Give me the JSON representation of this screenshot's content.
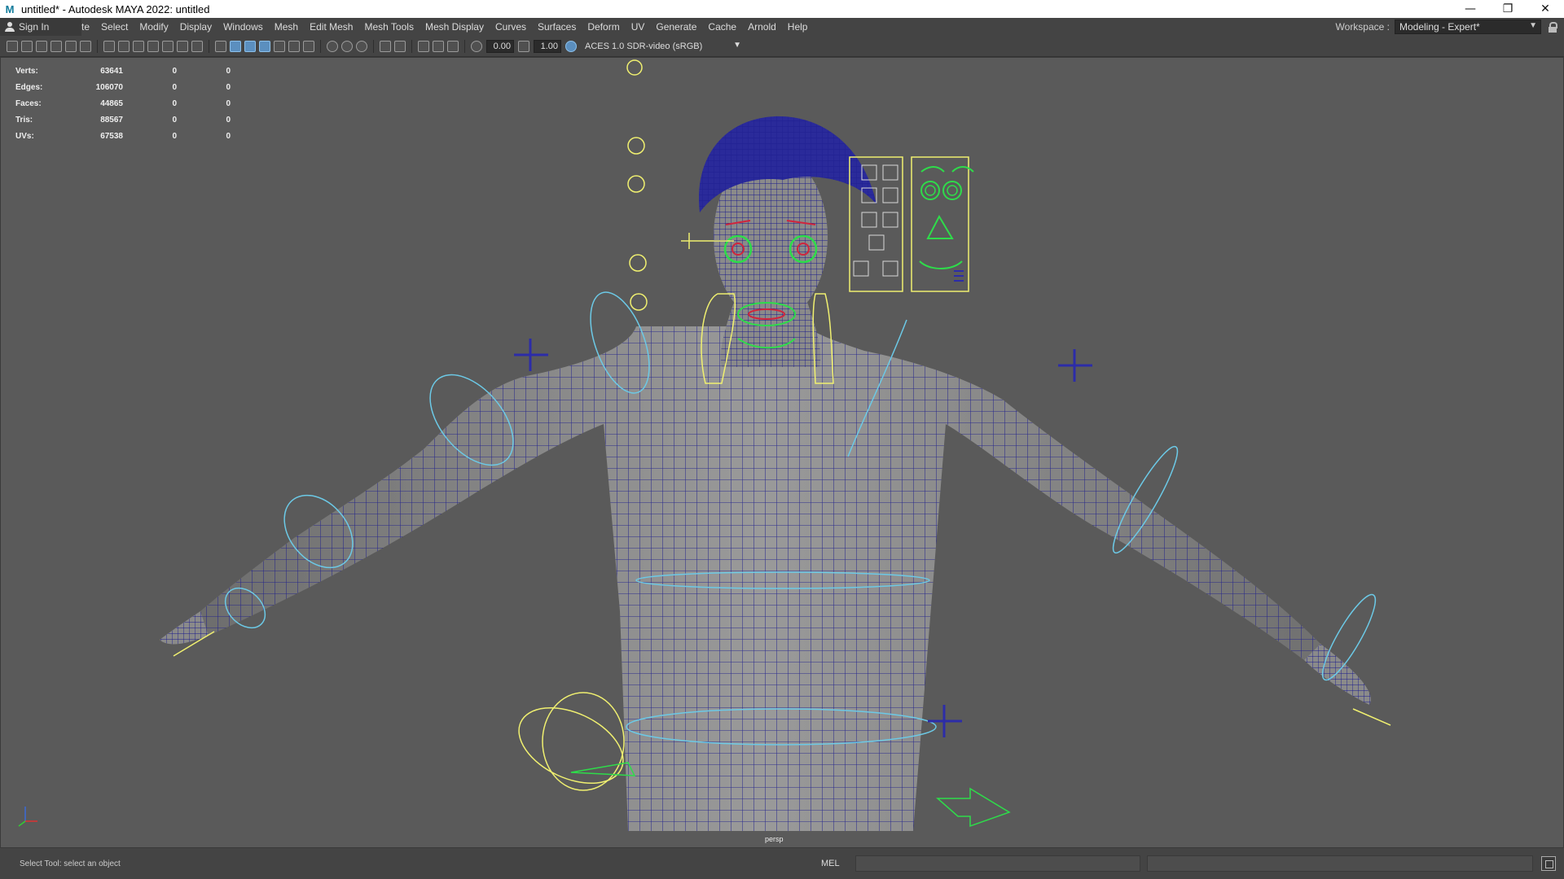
{
  "window": {
    "title": "untitled* - Autodesk MAYA 2022: untitled",
    "app_icon": "M",
    "controls": {
      "minimize": "—",
      "restore": "❐",
      "close": "✕"
    }
  },
  "menubar": {
    "sign_in": "Sign In",
    "menus": [
      "te",
      "Select",
      "Modify",
      "Display",
      "Windows",
      "Mesh",
      "Edit Mesh",
      "Mesh Tools",
      "Mesh Display",
      "Curves",
      "Surfaces",
      "Deform",
      "UV",
      "Generate",
      "Cache",
      "Arnold",
      "Help"
    ],
    "workspace_label": "Workspace :",
    "workspace_value": "Modeling - Expert*"
  },
  "toolbar": {
    "exposure": "0.00",
    "gamma": "1.00",
    "color_space": "ACES 1.0 SDR-video (sRGB)"
  },
  "hud": {
    "rows": [
      {
        "label": "Verts:",
        "values": [
          "63641",
          "0",
          "0"
        ]
      },
      {
        "label": "Edges:",
        "values": [
          "106070",
          "0",
          "0"
        ]
      },
      {
        "label": "Faces:",
        "values": [
          "44865",
          "0",
          "0"
        ]
      },
      {
        "label": "Tris:",
        "values": [
          "88567",
          "0",
          "0"
        ]
      },
      {
        "label": "UVs:",
        "values": [
          "67538",
          "0",
          "0"
        ]
      }
    ]
  },
  "viewport": {
    "camera_label": "persp",
    "colors": {
      "background": "#5a5a5a",
      "mesh": "#8a8a8a",
      "wire": "#1a1a8c",
      "controller_yellow": "#f0f070",
      "controller_cyan": "#6cc9e6",
      "controller_green": "#2edc4a",
      "controller_blue": "#2c2ca8",
      "controller_red": "#d0243c"
    }
  },
  "helpline": {
    "help_text": "Select Tool: select an object",
    "mel_label": "MEL"
  }
}
